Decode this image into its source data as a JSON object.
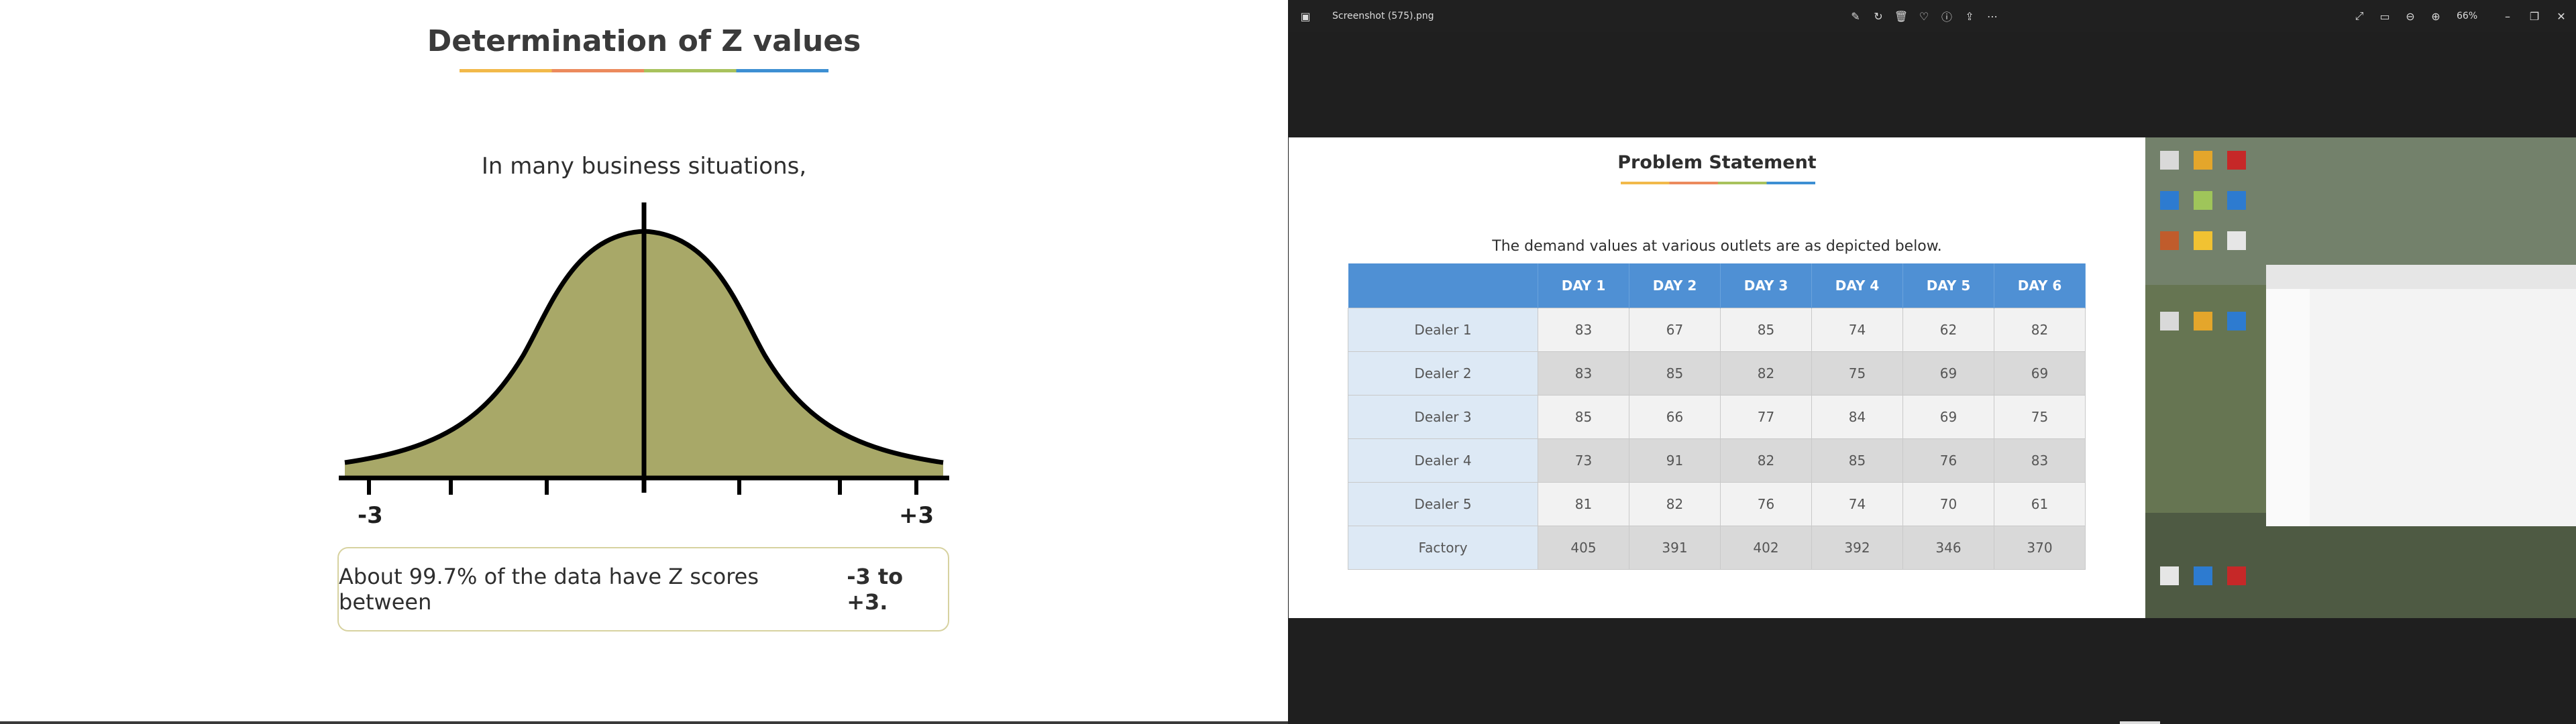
{
  "left_slide": {
    "title": "Determination of Z values",
    "intro": "In many business situations,",
    "axis_left_label": "-3",
    "axis_right_label": "+3",
    "callout_text": "About 99.7% of the data have Z scores between",
    "callout_bold": "-3 to +3."
  },
  "viewer": {
    "filename": "Screenshot (575).png",
    "zoom": "66%",
    "toolbar_icons": [
      "edit-icon",
      "rotate-icon",
      "delete-icon",
      "favorite-icon",
      "info-icon",
      "share-icon",
      "more-icon"
    ],
    "window_icons": [
      "fullscreen-icon",
      "slideshow-icon",
      "zoom-out-icon",
      "zoom-in-icon"
    ],
    "window_controls": [
      "minimize-icon",
      "restore-icon",
      "close-icon"
    ]
  },
  "problem": {
    "title": "Problem Statement",
    "intro": "The demand values at various outlets are as depicted below.",
    "headers": [
      "DAY 1",
      "DAY 2",
      "DAY 3",
      "DAY 4",
      "DAY 5",
      "DAY 6"
    ],
    "rows": [
      {
        "label": "Dealer 1",
        "values": [
          "83",
          "67",
          "85",
          "74",
          "62",
          "82"
        ]
      },
      {
        "label": "Dealer 2",
        "values": [
          "83",
          "85",
          "82",
          "75",
          "69",
          "69"
        ]
      },
      {
        "label": "Dealer 3",
        "values": [
          "85",
          "66",
          "77",
          "84",
          "69",
          "75"
        ]
      },
      {
        "label": "Dealer 4",
        "values": [
          "73",
          "91",
          "82",
          "85",
          "76",
          "83"
        ]
      },
      {
        "label": "Dealer 5",
        "values": [
          "81",
          "82",
          "76",
          "74",
          "70",
          "61"
        ]
      },
      {
        "label": "Factory",
        "values": [
          "405",
          "391",
          "402",
          "392",
          "346",
          "370"
        ]
      }
    ]
  },
  "colors": {
    "curve_fill": "#a8a868",
    "table_header": "#4f90d4",
    "row_label_bg": "#dde9f5"
  }
}
